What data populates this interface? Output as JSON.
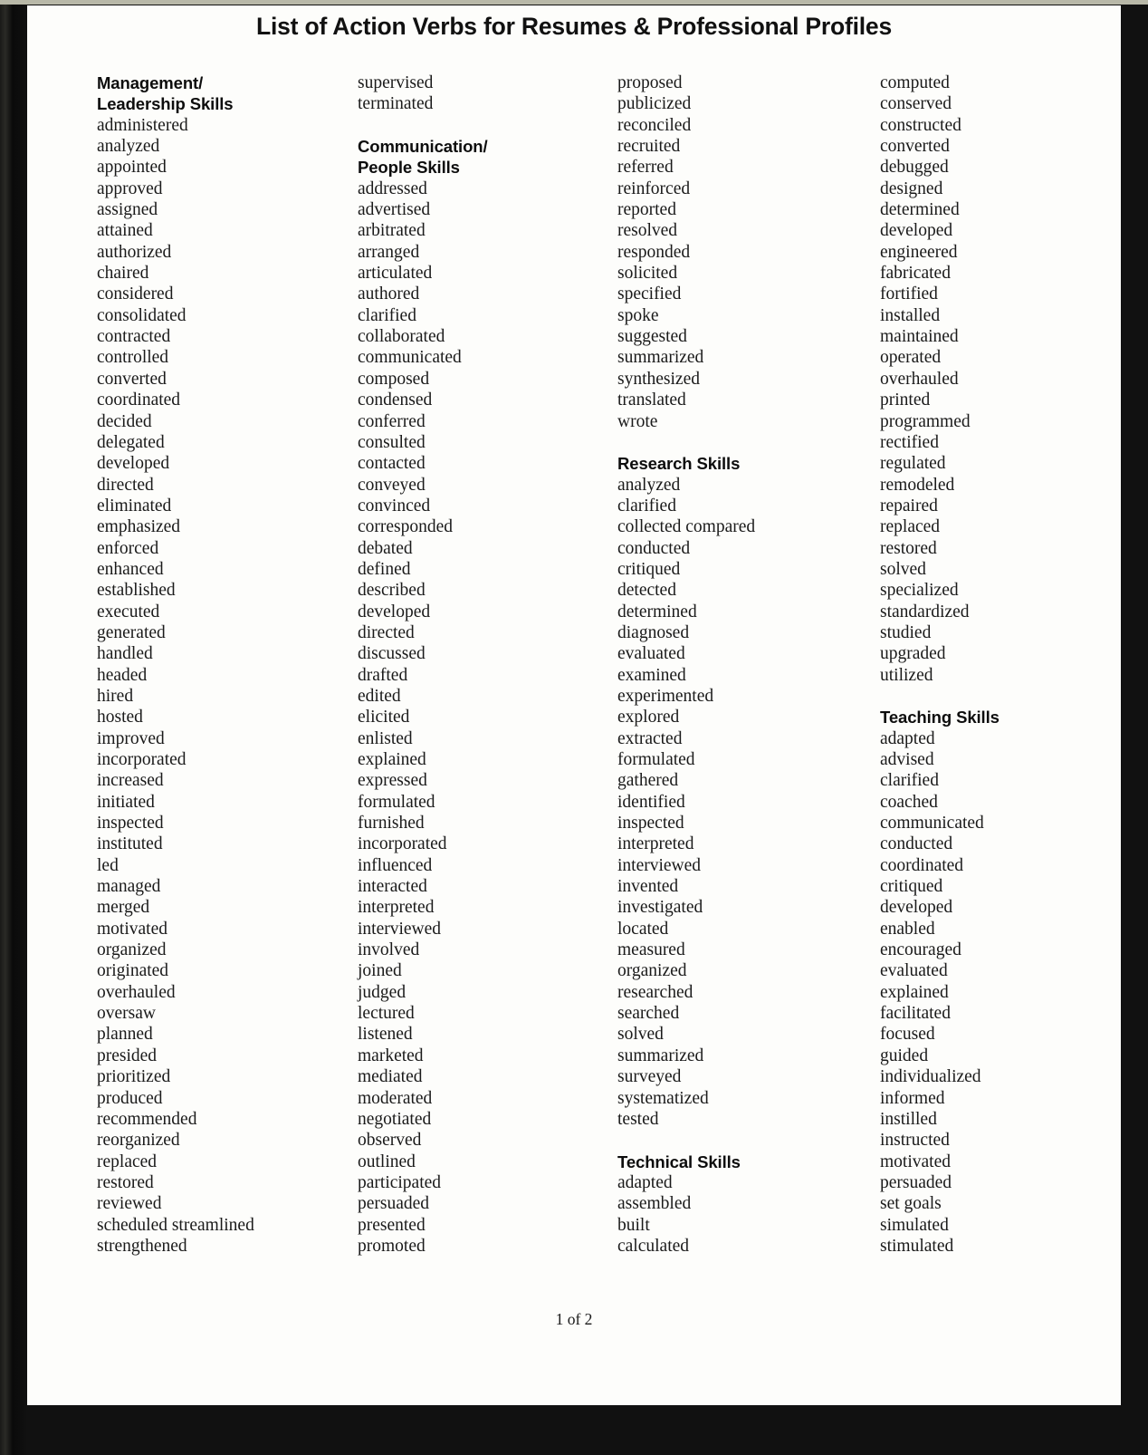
{
  "document": {
    "title": "List of Action Verbs for Resumes & Professional Profiles",
    "footer": "1 of 2",
    "page_background": "#fdfdfb",
    "frame_color": "#0c0c0c",
    "text_color": "#1a1a1a"
  },
  "columns": [
    {
      "index": 0,
      "blocks": [
        {
          "type": "heading",
          "lines": [
            "Management/",
            "Leadership Skills"
          ]
        },
        {
          "type": "list",
          "items": [
            "administered",
            "analyzed",
            "appointed",
            "approved",
            "assigned",
            "attained",
            "authorized",
            "chaired",
            "considered",
            "consolidated",
            "contracted",
            "controlled",
            "converted",
            "coordinated",
            "decided",
            "delegated",
            "developed",
            "directed",
            "eliminated",
            "emphasized",
            "enforced",
            "enhanced",
            "established",
            "executed",
            "generated",
            "handled",
            "headed",
            "hired",
            "hosted",
            "improved",
            "incorporated",
            "increased",
            "initiated",
            "inspected",
            "instituted",
            "led",
            "managed",
            "merged",
            "motivated",
            "organized",
            "originated",
            "overhauled",
            "oversaw",
            "planned",
            "presided",
            "prioritized",
            "produced",
            "recommended",
            "reorganized",
            "replaced",
            "restored",
            "reviewed",
            "scheduled streamlined",
            "strengthened"
          ]
        }
      ]
    },
    {
      "index": 1,
      "blocks": [
        {
          "type": "list",
          "items": [
            "supervised",
            "terminated"
          ]
        },
        {
          "type": "spacer"
        },
        {
          "type": "heading",
          "lines": [
            "Communication/",
            "People Skills"
          ]
        },
        {
          "type": "list",
          "items": [
            "addressed",
            "advertised",
            "arbitrated",
            "arranged",
            "articulated",
            "authored",
            "clarified",
            "collaborated",
            "communicated",
            "composed",
            "condensed",
            "conferred",
            "consulted",
            "contacted",
            "conveyed",
            "convinced",
            "corresponded",
            "debated",
            "defined",
            "described",
            "developed",
            "directed",
            "discussed",
            "drafted",
            "edited",
            "elicited",
            "enlisted",
            "explained",
            "expressed",
            "formulated",
            "furnished",
            "incorporated",
            "influenced",
            "interacted",
            "interpreted",
            "interviewed",
            "involved",
            "joined",
            "judged",
            "lectured",
            "listened",
            "marketed",
            "mediated",
            "moderated",
            "negotiated",
            "observed",
            "outlined",
            "participated",
            "persuaded",
            "presented",
            "promoted"
          ]
        }
      ]
    },
    {
      "index": 2,
      "blocks": [
        {
          "type": "list",
          "items": [
            "proposed",
            "publicized",
            "reconciled",
            "recruited",
            "referred",
            "reinforced",
            "reported",
            "resolved",
            "responded",
            "solicited",
            "specified",
            "spoke",
            "suggested",
            "summarized",
            "synthesized",
            "translated",
            "wrote"
          ]
        },
        {
          "type": "spacer"
        },
        {
          "type": "heading",
          "lines": [
            "Research Skills"
          ]
        },
        {
          "type": "list",
          "items": [
            "analyzed",
            "clarified",
            "collected compared",
            "conducted",
            "critiqued",
            "detected",
            "determined",
            "diagnosed",
            "evaluated",
            "examined",
            "experimented",
            "explored",
            "extracted",
            "formulated",
            "gathered",
            "identified",
            "inspected",
            "interpreted",
            "interviewed",
            "invented",
            "investigated",
            "located",
            "measured",
            "organized",
            "researched",
            "searched",
            "solved",
            "summarized",
            "surveyed",
            "systematized",
            "tested"
          ]
        },
        {
          "type": "spacer"
        },
        {
          "type": "heading",
          "lines": [
            "Technical Skills"
          ]
        },
        {
          "type": "list",
          "items": [
            "adapted",
            "assembled",
            "built",
            "calculated"
          ]
        }
      ]
    },
    {
      "index": 3,
      "blocks": [
        {
          "type": "list",
          "items": [
            "computed",
            "conserved",
            "constructed",
            "converted",
            "debugged",
            "designed",
            "determined",
            "developed",
            "engineered",
            "fabricated",
            "fortified",
            "installed",
            "maintained",
            "operated",
            "overhauled",
            "printed",
            "programmed",
            "rectified",
            "regulated",
            "remodeled",
            "repaired",
            "replaced",
            "restored",
            "solved",
            "specialized",
            "standardized",
            "studied",
            "upgraded",
            "utilized"
          ]
        },
        {
          "type": "spacer"
        },
        {
          "type": "heading",
          "lines": [
            "Teaching Skills"
          ]
        },
        {
          "type": "list",
          "items": [
            "adapted",
            "advised",
            "clarified",
            "coached",
            "communicated",
            "conducted",
            "coordinated",
            "critiqued",
            "developed",
            "enabled",
            "encouraged",
            "evaluated",
            "explained",
            "facilitated",
            "focused",
            "guided",
            "individualized",
            "informed",
            "instilled",
            "instructed",
            "motivated",
            "persuaded",
            "set goals",
            "simulated",
            "stimulated"
          ]
        }
      ]
    }
  ]
}
